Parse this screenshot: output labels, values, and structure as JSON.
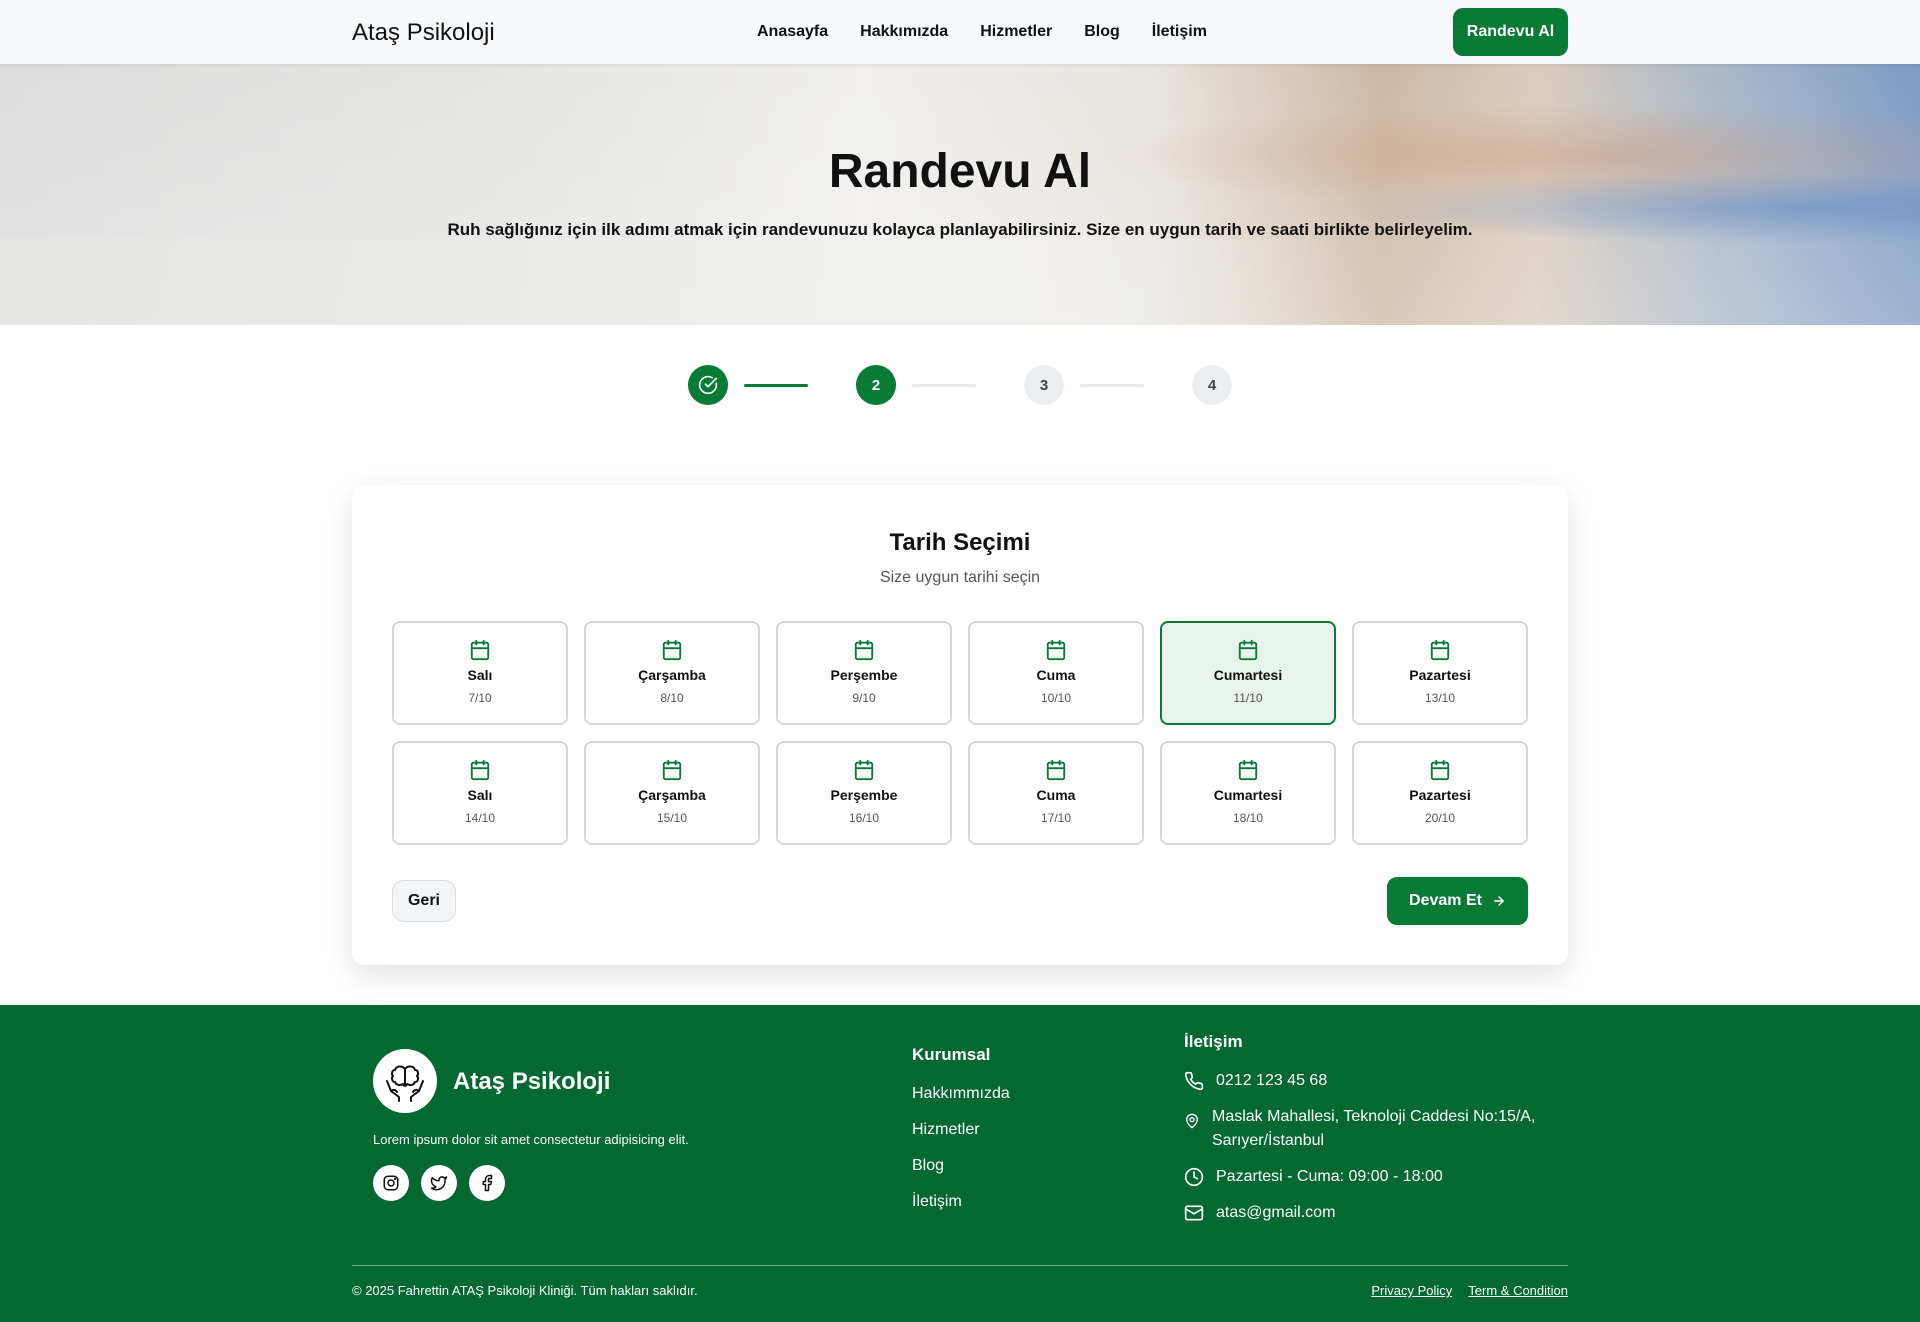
{
  "nav": {
    "brand": "Ataş Psikoloji",
    "links": [
      "Anasayfa",
      "Hakkımızda",
      "Hizmetler",
      "Blog",
      "İletişim"
    ],
    "cta": "Randevu Al"
  },
  "hero": {
    "title": "Randevu Al",
    "subtitle": "Ruh sağlığınız için ilk adımı atmak için randevunuzu kolayca planlayabilirsiniz. Size en uygun tarih ve saati birlikte belirleyelim."
  },
  "stepper": {
    "steps": [
      {
        "label": "",
        "state": "done"
      },
      {
        "label": "2",
        "state": "active"
      },
      {
        "label": "3",
        "state": "todo"
      },
      {
        "label": "4",
        "state": "todo"
      }
    ]
  },
  "date_selection": {
    "title": "Tarih Seçimi",
    "subtitle": "Size uygun tarihi seçin",
    "dates": [
      {
        "day": "Salı",
        "date": "7/10",
        "selected": false
      },
      {
        "day": "Çarşamba",
        "date": "8/10",
        "selected": false
      },
      {
        "day": "Perşembe",
        "date": "9/10",
        "selected": false
      },
      {
        "day": "Cuma",
        "date": "10/10",
        "selected": false
      },
      {
        "day": "Cumartesi",
        "date": "11/10",
        "selected": true
      },
      {
        "day": "Pazartesi",
        "date": "13/10",
        "selected": false
      },
      {
        "day": "Salı",
        "date": "14/10",
        "selected": false
      },
      {
        "day": "Çarşamba",
        "date": "15/10",
        "selected": false
      },
      {
        "day": "Perşembe",
        "date": "16/10",
        "selected": false
      },
      {
        "day": "Cuma",
        "date": "17/10",
        "selected": false
      },
      {
        "day": "Cumartesi",
        "date": "18/10",
        "selected": false
      },
      {
        "day": "Pazartesi",
        "date": "20/10",
        "selected": false
      }
    ],
    "back_label": "Geri",
    "next_label": "Devam Et"
  },
  "footer": {
    "brand": "Ataş Psikoloji",
    "description": "Lorem ipsum dolor sit amet consectetur adipisicing elit.",
    "socials": [
      "instagram-icon",
      "twitter-icon",
      "facebook-icon"
    ],
    "corporate_heading": "Kurumsal",
    "corporate_links": [
      "Hakkımmızda",
      "Hizmetler",
      "Blog",
      "İletişim"
    ],
    "contact_heading": "İletişim",
    "phone": "0212 123 45 68",
    "address_line1": "Maslak Mahallesi, Teknoloji Caddesi No:15/A,",
    "address_line2": "Sarıyer/İstanbul",
    "hours": "Pazartesi - Cuma: 09:00 - 18:00",
    "email": "atas@gmail.com",
    "copyright": "© 2025 Fahrettin ATAŞ Psikoloji Kliniği. Tüm hakları saklıdır.",
    "privacy": "Privacy Policy",
    "terms": "Term & Condition"
  },
  "colors": {
    "primary": "#077a36",
    "footer_bg": "#036931",
    "selected_bg": "#e8f3ec"
  }
}
